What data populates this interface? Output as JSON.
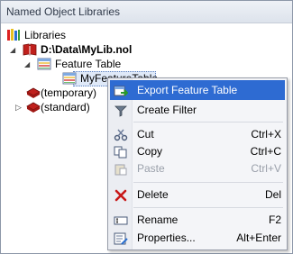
{
  "panel": {
    "title": "Named Object Libraries"
  },
  "tree": {
    "root": "Libraries",
    "library": "D:\\Data\\MyLib.nol",
    "feature_table": "Feature Table",
    "item": "MyFeatureTable",
    "temporary": "(temporary)",
    "standard": "(standard)"
  },
  "menu": {
    "export": "Export Feature Table",
    "create_filter": "Create Filter",
    "cut": "Cut",
    "cut_sc": "Ctrl+X",
    "copy": "Copy",
    "copy_sc": "Ctrl+C",
    "paste": "Paste",
    "paste_sc": "Ctrl+V",
    "delete": "Delete",
    "delete_sc": "Del",
    "rename": "Rename",
    "rename_sc": "F2",
    "properties": "Properties...",
    "properties_sc": "Alt+Enter"
  },
  "colors": {
    "highlight": "#2e6bd2",
    "library_red": "#c0201c"
  }
}
